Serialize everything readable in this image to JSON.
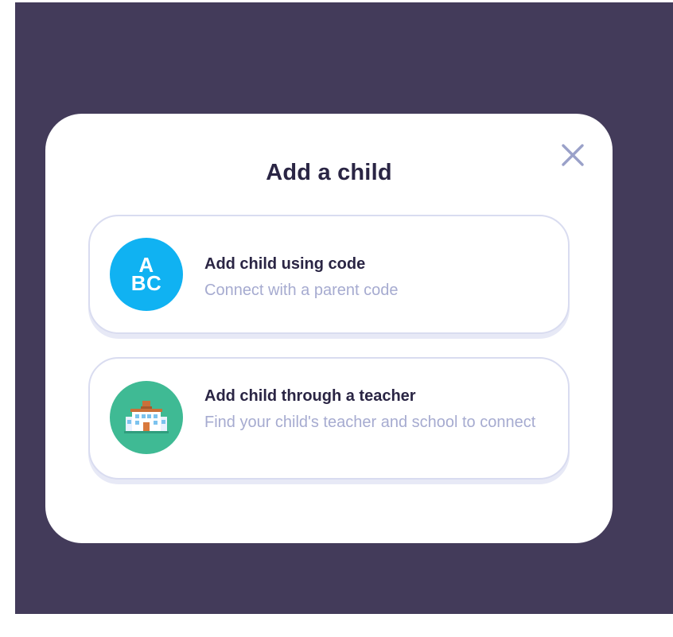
{
  "modal": {
    "title": "Add a child",
    "close_icon": "close-icon"
  },
  "options": [
    {
      "title": "Add child using code",
      "subtitle": "Connect with a parent code",
      "icon": "abc-letters-icon",
      "icon_text": "A BC",
      "icon_color": "#10b2f2"
    },
    {
      "title": "Add child through a teacher",
      "subtitle": "Find your child's teacher and school to connect",
      "icon": "school-building-icon",
      "icon_color": "#3fba94"
    }
  ],
  "colors": {
    "backdrop": "#433b5a",
    "modal": "#ffffff",
    "title_text": "#2a2544",
    "subtitle_text": "#a6abd0",
    "card_border": "#d9dcf0",
    "close_icon": "#9aa1c9"
  }
}
